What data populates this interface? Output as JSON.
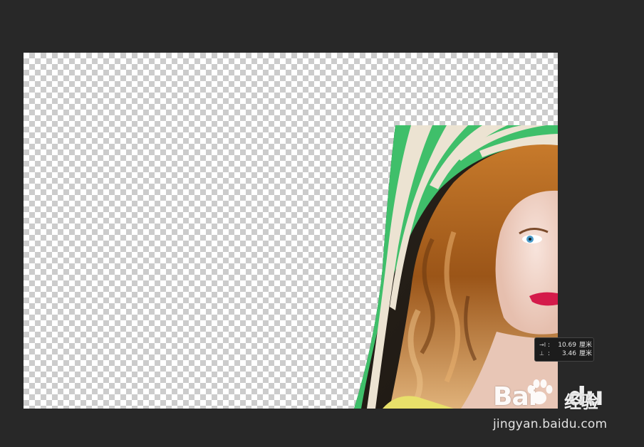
{
  "readout": {
    "horizontal_icon": "→I",
    "horizontal_value": "10.69",
    "horizontal_unit": "厘米",
    "vertical_icon": "⊥",
    "vertical_value": "3.46",
    "vertical_unit": "厘米"
  },
  "watermark": {
    "logo_text": "Bai",
    "logo_tail": "du",
    "suffix": "经验",
    "url": "jingyan.baidu.com"
  },
  "colors": {
    "workspace": "#282828",
    "checker_dark": "#cccccc",
    "checker_light": "#ffffff",
    "hat_green": "#3fbf6a",
    "hat_cream": "#ece3d2",
    "hair": "#b86a22",
    "skin": "#f2d6cc",
    "lips": "#d41b4a"
  },
  "icons": {
    "horizontal": "move-horizontal-icon",
    "vertical": "move-vertical-icon",
    "paw": "baidu-paw-icon"
  }
}
